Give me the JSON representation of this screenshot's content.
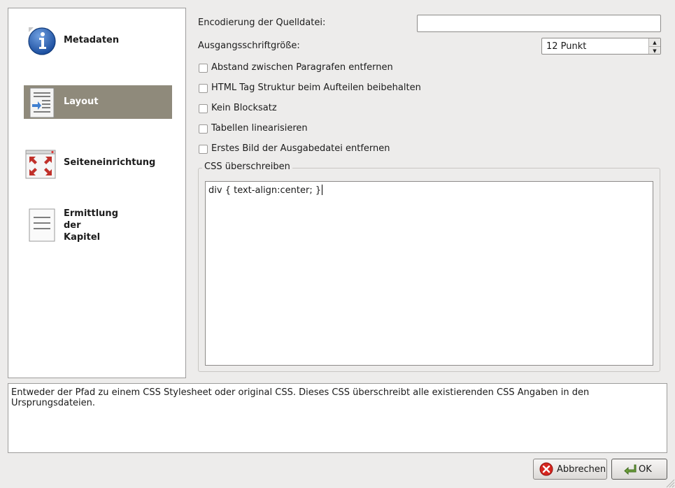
{
  "sidebar": {
    "items": [
      {
        "label": "Metadaten",
        "icon": "info-icon",
        "active": false
      },
      {
        "label": "Layout",
        "icon": "layout-icon",
        "active": true
      },
      {
        "label": "Seiteneinrichtung",
        "icon": "page-setup-icon",
        "active": false
      },
      {
        "label": "Ermittlung der Kapitel",
        "label_lines": [
          "Ermittlung",
          "der",
          "Kapitel"
        ],
        "icon": "document-icon",
        "active": false
      }
    ]
  },
  "form": {
    "encoding_label": "Encodierung der Quelldatei:",
    "encoding_value": "",
    "font_size_label": "Ausgangsschriftgröße:",
    "font_size_value": "12 Punkt",
    "checkboxes": [
      {
        "label": "Abstand zwischen Paragrafen entfernen",
        "checked": false
      },
      {
        "label": "HTML Tag Struktur beim Aufteilen beibehalten",
        "checked": false
      },
      {
        "label": "Kein Blocksatz",
        "checked": false
      },
      {
        "label": "Tabellen linearisieren",
        "checked": false
      },
      {
        "label": "Erstes Bild der Ausgabedatei entfernen",
        "checked": false
      }
    ],
    "css_legend": "CSS überschreiben",
    "css_value": "div { text-align:center; }"
  },
  "help": {
    "text": "Entweder der Pfad zu einem CSS Stylesheet oder original CSS. Dieses CSS überschreibt alle existierenden CSS Angaben in den Ursprungsdateien."
  },
  "buttons": {
    "cancel_label": "Abbrechen",
    "ok_label": "OK"
  },
  "colors": {
    "active_item": "#8f8a7b",
    "background": "#edeceb"
  }
}
